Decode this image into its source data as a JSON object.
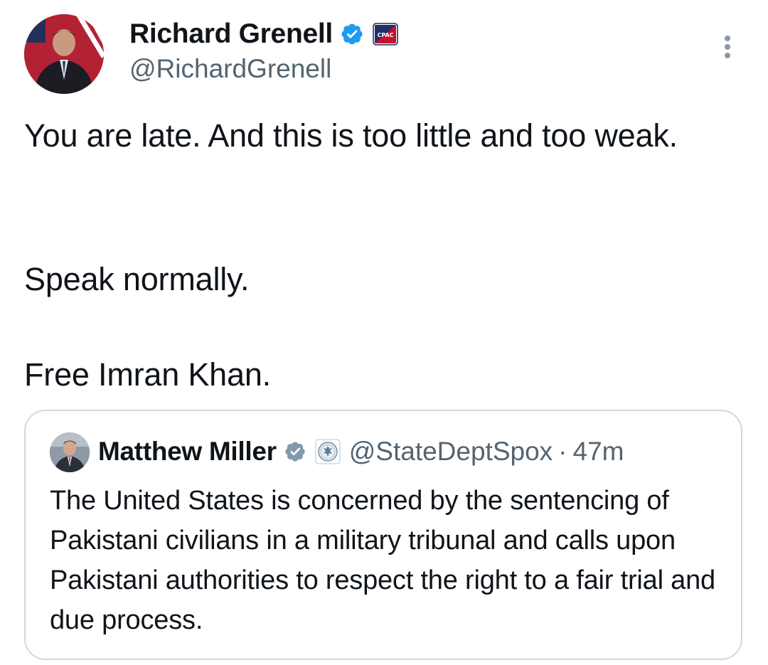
{
  "author": {
    "display_name": "Richard Grenell",
    "handle": "@RichardGrenell",
    "avatar_icon": "profile-photo-icon",
    "verified_icon": "verified-badge-icon",
    "affiliation_icon": "cpac-affiliation-icon",
    "affiliation_label": "CPAC"
  },
  "tweet": {
    "paragraphs": [
      "You are late. And this is too little and too weak.",
      "Speak normally.",
      "Free Imran Khan."
    ]
  },
  "more_button": {
    "icon": "more-options-icon"
  },
  "quoted_tweet": {
    "display_name": "Matthew Miller",
    "handle": "@StateDeptSpox",
    "separator": "·",
    "timestamp": "47m",
    "verified_icon": "gray-verified-badge-icon",
    "affiliation_icon": "state-department-seal-icon",
    "text": "The United States is concerned by the sentencing of Pakistani civilians in a military tribunal and calls upon Pakistani authorities to respect the right to a fair trial and due process."
  },
  "colors": {
    "primary_text": "#0f1419",
    "secondary_text": "#536471",
    "verified_blue": "#1d9bf0",
    "government_gray": "#829aab",
    "border": "#cfd9de"
  }
}
